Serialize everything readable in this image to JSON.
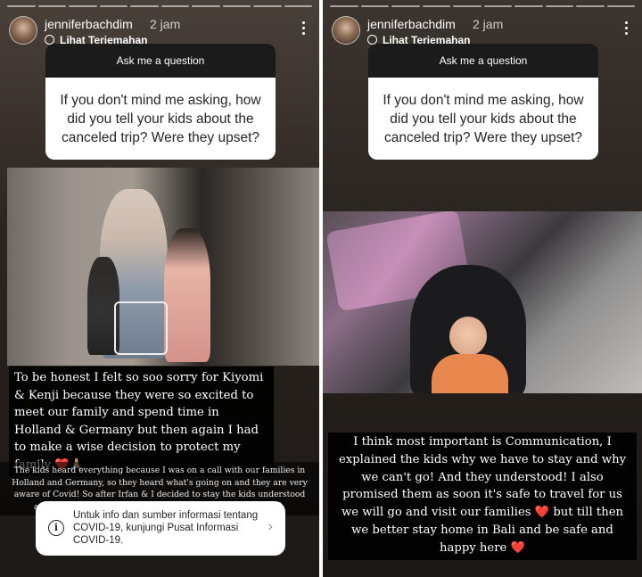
{
  "stories": {
    "left": {
      "username": "jenniferbachdim",
      "time": "2 jam",
      "translate": "Lihat Terjemahan",
      "question_header": "Ask me a question",
      "question_text": "If you don't mind me asking, how did you tell your kids about the canceled trip? Were they upset?",
      "caption_main": "To be honest I felt so soo sorry for Kiyomi & Kenji because they were so excited to meet our family and spend time in Holland & Germany but then again I had to make a wise decision to protect my family ❤️🙏🏼",
      "caption_small": "The kids heard everything because I was on a call with our families in Holland and Germany, so they heard what's going on and they are very aware of Covid! So after Irfan & I decided to stay the kids understood and they ... g hug and kisses ... mature girl ... bly the Bali 🙏🏼"
    },
    "right": {
      "username": "jenniferbachdim",
      "time": "2 jam",
      "translate": "Lihat Terjemahan",
      "question_header": "Ask me a question",
      "question_text": "If you don't mind me asking, how did you tell your kids about the canceled trip? Were they upset?",
      "caption_main": "I think most important is Communication, I explained the kids why we have to stay and why we can't go! And they understood! I also promised them as soon it's safe to travel for us we will go and visit our families ❤️ but till then we better stay home in Bali and be safe and happy here ❤️"
    }
  },
  "covid_banner": {
    "text": "Untuk info dan sumber informasi tentang COVID-19, kunjungi Pusat Informasi COVID-19.",
    "icon": "info-icon",
    "chevron": "›"
  }
}
